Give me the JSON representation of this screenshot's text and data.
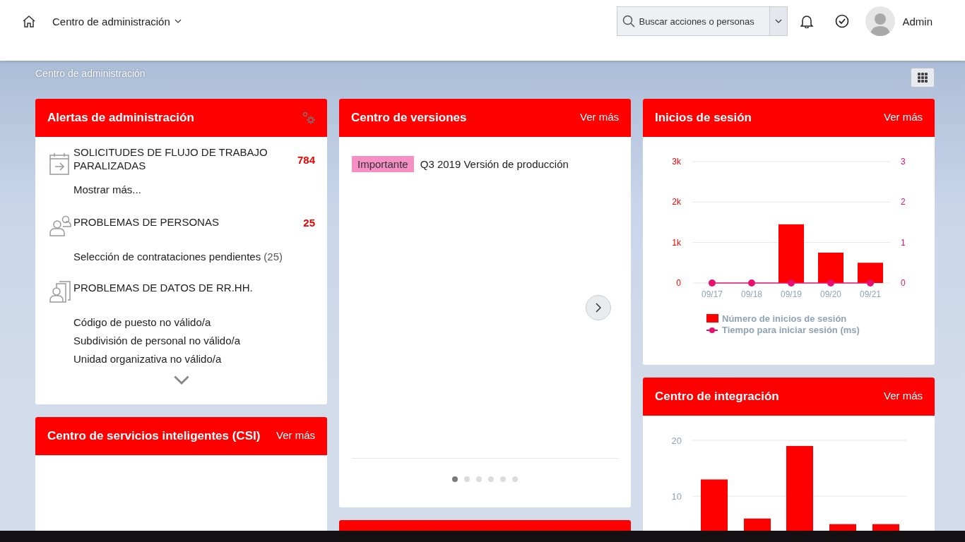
{
  "header": {
    "title": "Centro de administración",
    "search": {
      "placeholder": "Buscar acciones o personas"
    },
    "user": "Admin"
  },
  "breadcrumb": "Centro de administración",
  "alerts": {
    "title": "Alertas de administración",
    "groups": [
      {
        "kind": "workflow",
        "title": "SOLICITUDES DE FLUJO DE TRABAJO PARALIZADAS",
        "count": "784",
        "items": [
          {
            "label": "Mostrar más..."
          }
        ]
      },
      {
        "kind": "people",
        "title": "PROBLEMAS DE PERSONAS",
        "count": "25",
        "items": [
          {
            "label": "Selección de contrataciones pendientes",
            "count": "(25)"
          }
        ]
      },
      {
        "kind": "hrdata",
        "title": "PROBLEMAS DE DATOS DE RR.HH.",
        "items": [
          {
            "label": "Código de puesto no válido/a"
          },
          {
            "label": "Subdivisión de personal no válido/a"
          },
          {
            "label": "Unidad organizativa no válido/a"
          }
        ]
      }
    ]
  },
  "csi": {
    "title": "Centro de servicios inteligentes (CSI)",
    "link": "Ver más"
  },
  "versions": {
    "title": "Centro de versiones",
    "link": "Ver más",
    "releases": [
      {
        "tag": "Importante",
        "title": "Q3 2019 Versión de producción"
      }
    ],
    "dots": [
      {
        "selected": true
      },
      {
        "selected": false
      },
      {
        "selected": false
      },
      {
        "selected": false
      },
      {
        "selected": false
      },
      {
        "selected": false
      }
    ]
  },
  "logins": {
    "title": "Inicios de sesión",
    "link": "Ver más",
    "chart_data": {
      "type": "bar",
      "categories": [
        "09/17",
        "09/18",
        "09/19",
        "09/20",
        "09/21"
      ],
      "series": [
        {
          "name": "Número de inicios de sesión",
          "color": "#ff0000",
          "values": [
            0,
            0,
            1450,
            750,
            500
          ]
        },
        {
          "name": "Tiempo para iniciar sesión (ms)",
          "type": "line",
          "marker": "circle",
          "color": "#e8106e",
          "values": [
            0,
            0,
            0,
            0,
            0
          ]
        }
      ],
      "legend": "bottom",
      "ylim": [
        0,
        3000
      ],
      "yticks": [
        {
          "value": 0,
          "label": "0"
        },
        {
          "value": 1000,
          "label": "1k"
        },
        {
          "value": 2000,
          "label": "2k"
        },
        {
          "value": 3000,
          "label": "3k"
        }
      ],
      "y2lim": [
        0,
        3
      ],
      "y2ticks": [
        {
          "value": 0,
          "label": "0"
        },
        {
          "value": 1,
          "label": "1"
        },
        {
          "value": 2,
          "label": "2"
        },
        {
          "value": 3,
          "label": "3"
        }
      ]
    }
  },
  "integration": {
    "title": "Centro de integración",
    "link": "Ver más",
    "chart_data": {
      "type": "bar",
      "series": [
        {
          "color": "#ff0000",
          "values": [
            13,
            6,
            19,
            5,
            5
          ]
        }
      ],
      "ylim": [
        3.7,
        20
      ],
      "yticks": [
        {
          "value": 10,
          "label": "10"
        },
        {
          "value": 20,
          "label": "20"
        }
      ]
    }
  }
}
